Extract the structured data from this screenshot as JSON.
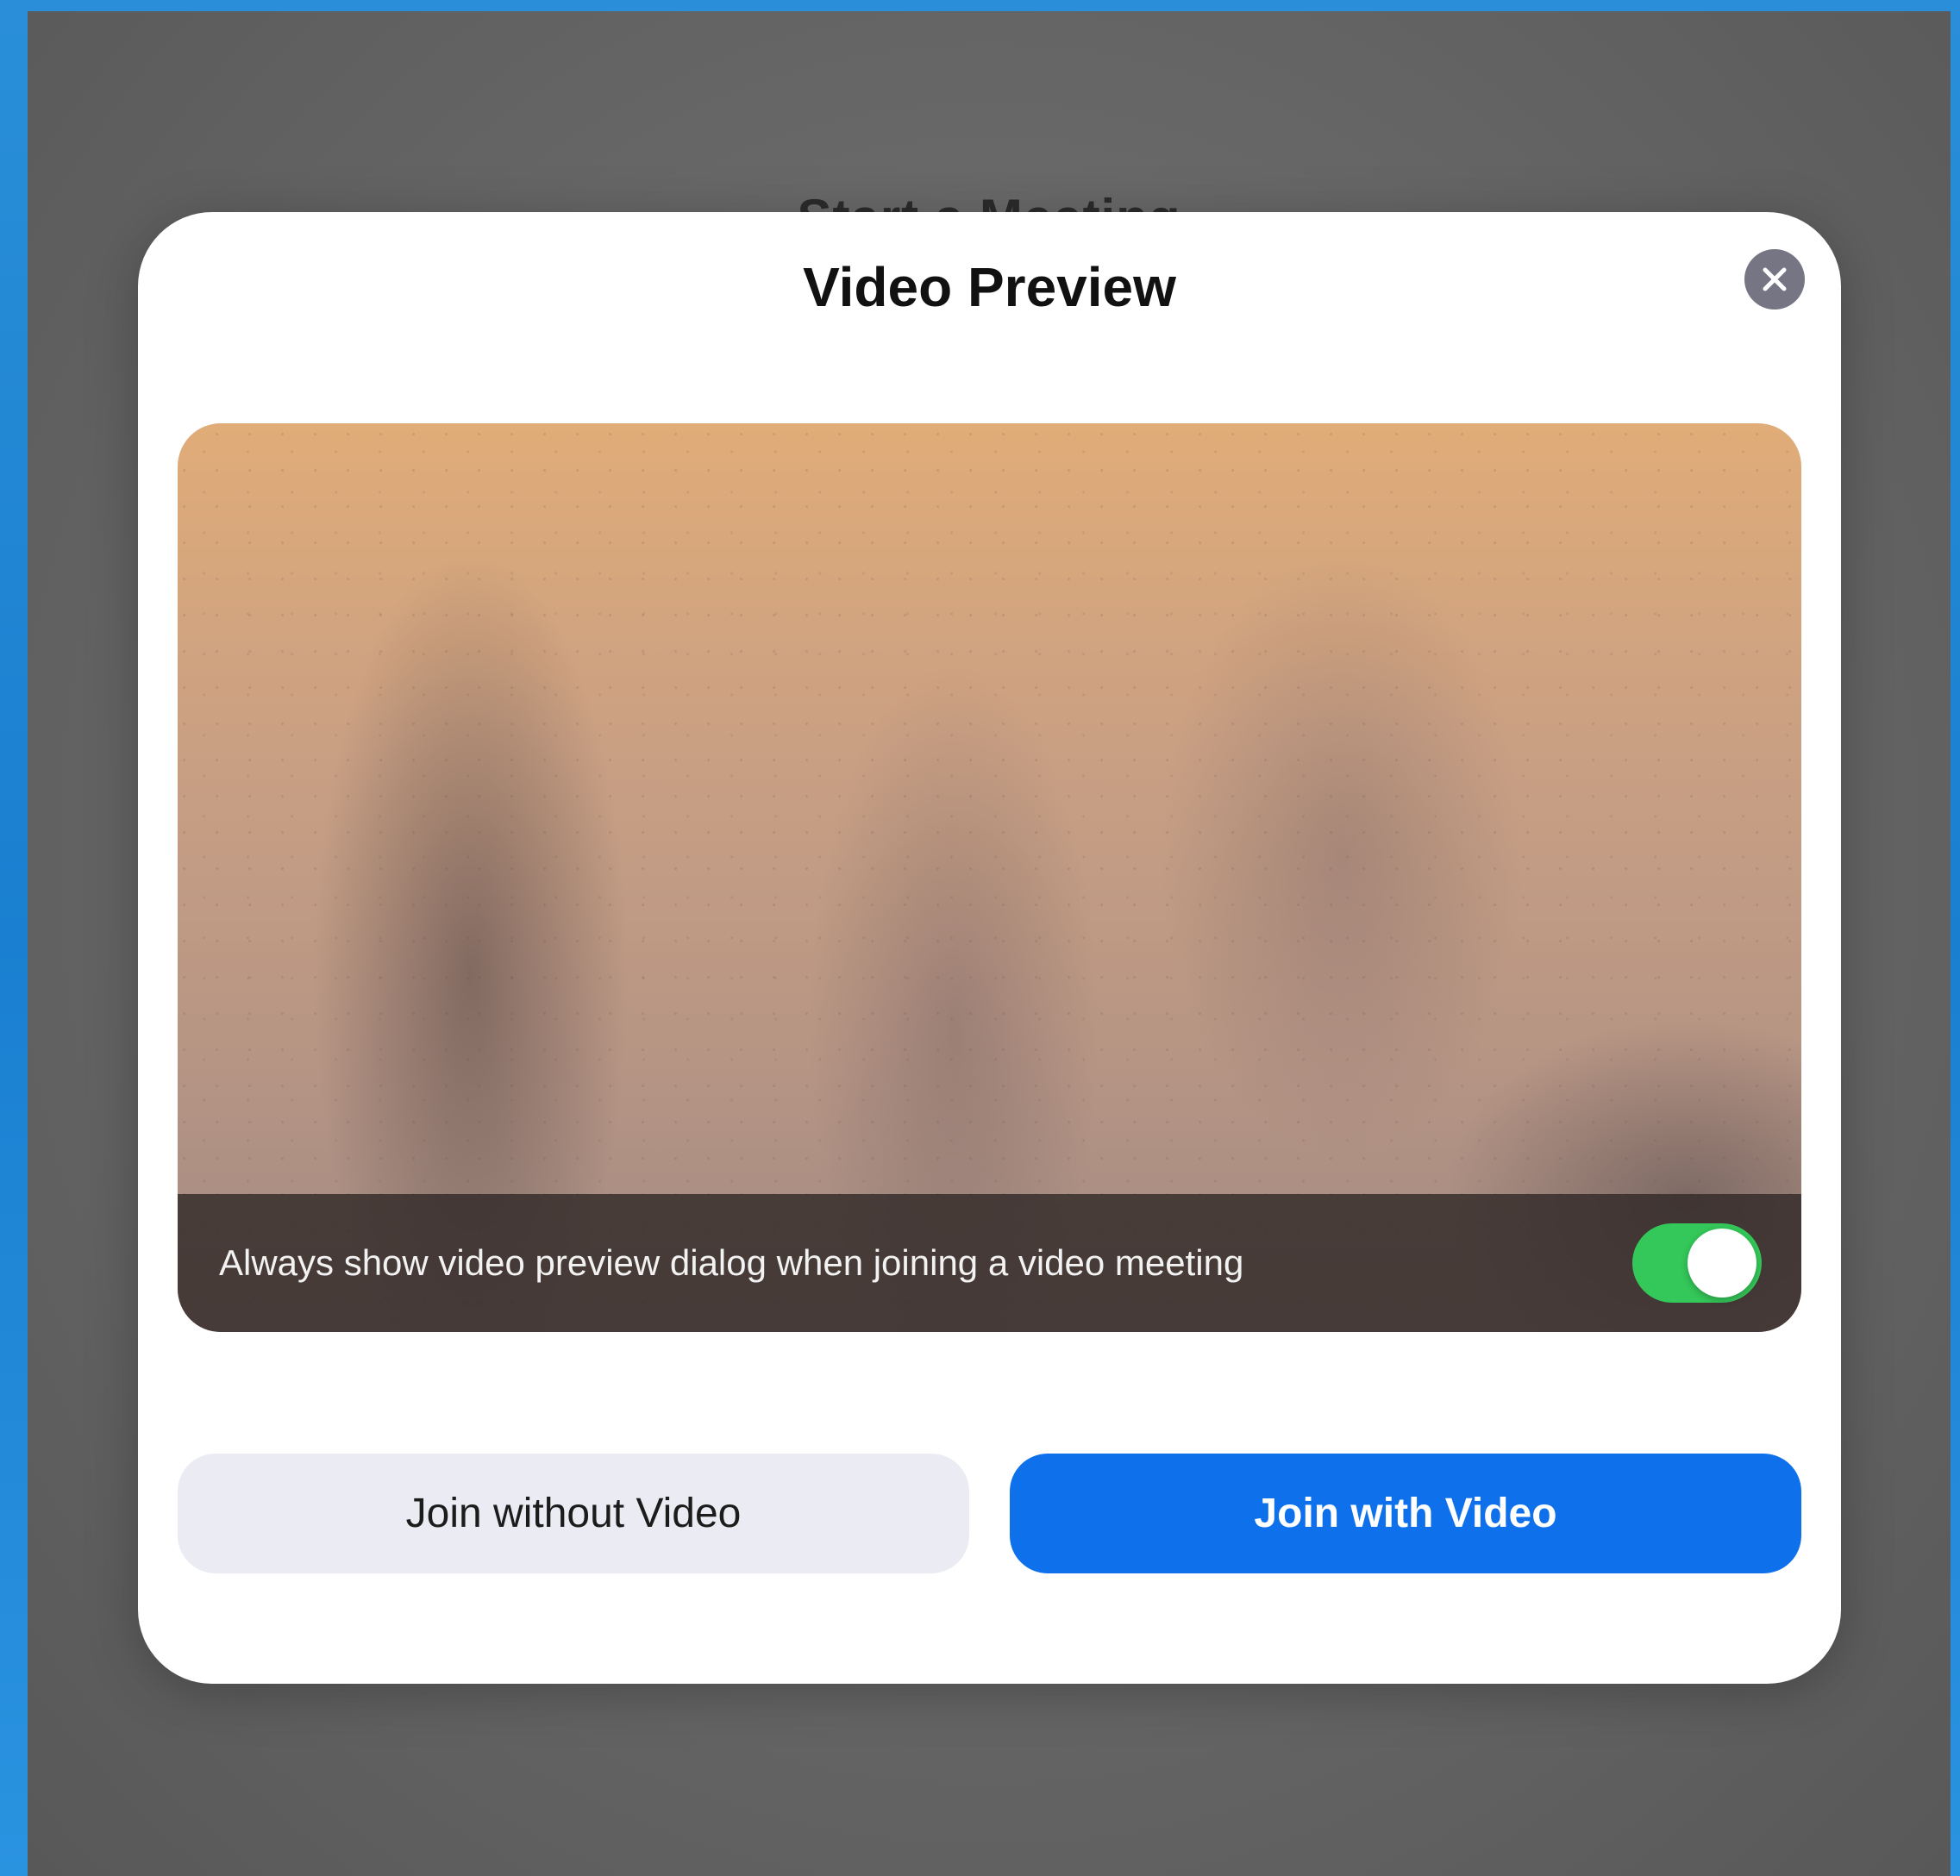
{
  "background": {
    "title": "Start a Meeting"
  },
  "dialog": {
    "title": "Video Preview",
    "close_icon": "close-icon",
    "preview": {
      "always_show_label": "Always show video preview dialog when joining a video meeting",
      "toggle_on": true,
      "toggle_color": "#34c759"
    },
    "buttons": {
      "join_without_video": "Join without Video",
      "join_with_video": "Join with Video",
      "primary_color": "#0e71eb"
    }
  }
}
